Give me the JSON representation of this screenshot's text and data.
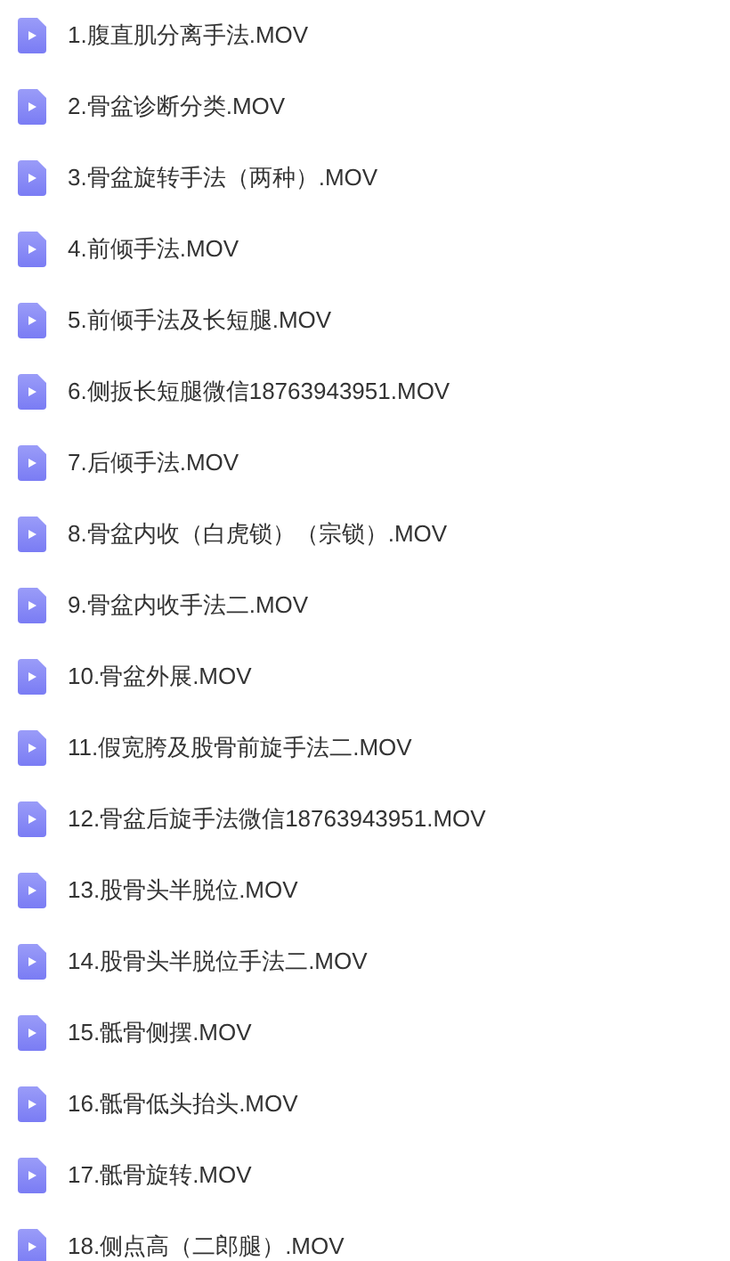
{
  "files": [
    {
      "name": "1.腹直肌分离手法.MOV"
    },
    {
      "name": "2.骨盆诊断分类.MOV"
    },
    {
      "name": "3.骨盆旋转手法（两种）.MOV"
    },
    {
      "name": "4.前倾手法.MOV"
    },
    {
      "name": "5.前倾手法及长短腿.MOV"
    },
    {
      "name": "6.侧扳长短腿微信18763943951.MOV"
    },
    {
      "name": "7.后倾手法.MOV"
    },
    {
      "name": "8.骨盆内收（白虎锁）（宗锁）.MOV"
    },
    {
      "name": "9.骨盆内收手法二.MOV"
    },
    {
      "name": "10.骨盆外展.MOV"
    },
    {
      "name": "11.假宽胯及股骨前旋手法二.MOV"
    },
    {
      "name": "12.骨盆后旋手法微信18763943951.MOV"
    },
    {
      "name": "13.股骨头半脱位.MOV"
    },
    {
      "name": "14.股骨头半脱位手法二.MOV"
    },
    {
      "name": "15.骶骨侧摆.MOV"
    },
    {
      "name": "16.骶骨低头抬头.MOV"
    },
    {
      "name": "17.骶骨旋转.MOV"
    },
    {
      "name": "18.侧点高（二郎腿）.MOV"
    }
  ]
}
